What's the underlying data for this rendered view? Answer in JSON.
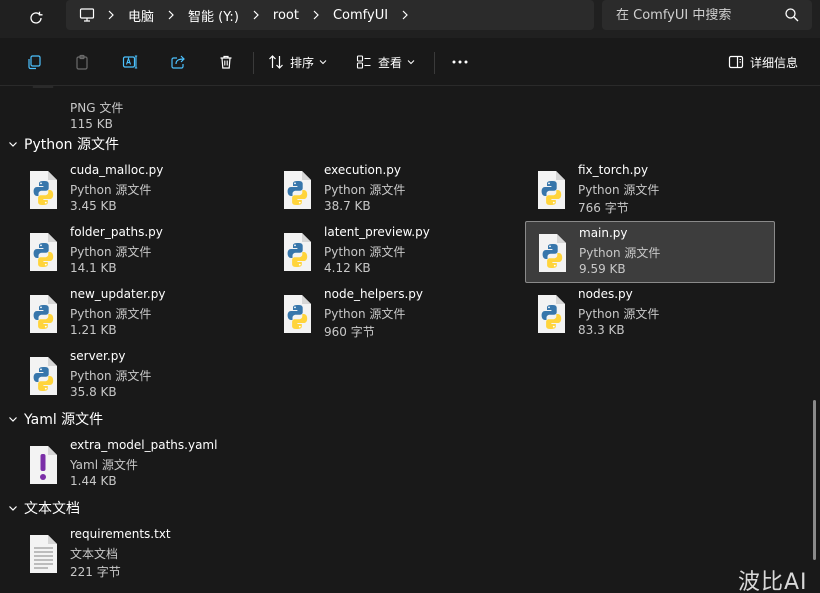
{
  "address": {
    "crumbs": [
      "电脑",
      "智能 (Y:)",
      "root",
      "ComfyUI"
    ]
  },
  "search": {
    "placeholder": "在 ComfyUI 中搜索"
  },
  "toolbar": {
    "sort_label": "排序",
    "view_label": "查看",
    "details_label": "详细信息"
  },
  "partial_item": {
    "type": "PNG 文件",
    "size": "115 KB"
  },
  "groups": [
    {
      "label": "Python 源文件",
      "items": [
        {
          "name": "cuda_malloc.py",
          "type": "Python 源文件",
          "size": "3.45 KB"
        },
        {
          "name": "execution.py",
          "type": "Python 源文件",
          "size": "38.7 KB"
        },
        {
          "name": "fix_torch.py",
          "type": "Python 源文件",
          "size": "766 字节"
        },
        {
          "name": "folder_paths.py",
          "type": "Python 源文件",
          "size": "14.1 KB"
        },
        {
          "name": "latent_preview.py",
          "type": "Python 源文件",
          "size": "4.12 KB"
        },
        {
          "name": "main.py",
          "type": "Python 源文件",
          "size": "9.59 KB"
        },
        {
          "name": "new_updater.py",
          "type": "Python 源文件",
          "size": "1.21 KB"
        },
        {
          "name": "node_helpers.py",
          "type": "Python 源文件",
          "size": "960 字节"
        },
        {
          "name": "nodes.py",
          "type": "Python 源文件",
          "size": "83.3 KB"
        },
        {
          "name": "server.py",
          "type": "Python 源文件",
          "size": "35.8 KB"
        }
      ]
    },
    {
      "label": "Yaml 源文件",
      "items": [
        {
          "name": "extra_model_paths.yaml",
          "type": "Yaml 源文件",
          "size": "1.44 KB"
        }
      ]
    },
    {
      "label": "文本文档",
      "items": [
        {
          "name": "requirements.txt",
          "type": "文本文档",
          "size": "221 字节"
        }
      ]
    }
  ],
  "selected_item": "main.py",
  "watermark": "波比AI"
}
